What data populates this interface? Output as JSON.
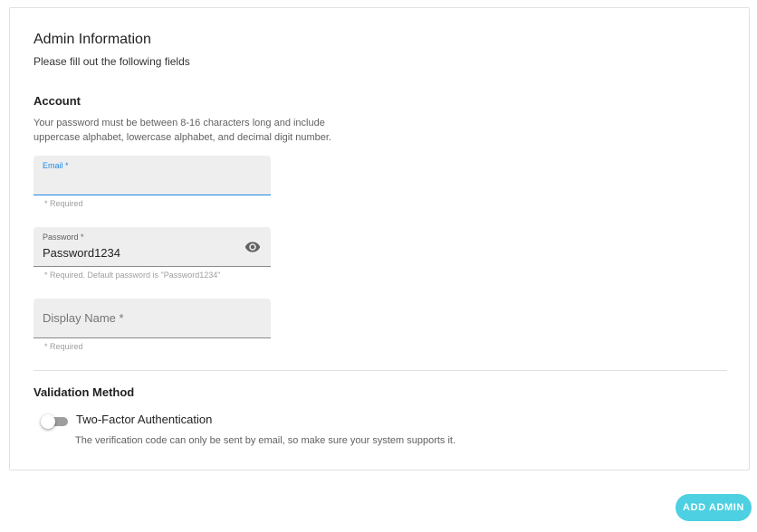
{
  "header": {
    "title": "Admin Information",
    "subtitle": "Please fill out the following fields"
  },
  "account": {
    "title": "Account",
    "hint_line1": "Your password must be between 8-16 characters long and include",
    "hint_line2": "uppercase alphabet, lowercase alphabet, and decimal digit number.",
    "email": {
      "label": "Email *",
      "value": "",
      "helper": "* Required"
    },
    "password": {
      "label": "Password *",
      "value": "Password1234",
      "helper": "* Required. Default password is \"Password1234\"",
      "icon": "eye-icon"
    },
    "display_name": {
      "label": "Display Name *",
      "value": "",
      "helper": "* Required"
    }
  },
  "validation": {
    "title": "Validation Method",
    "two_factor": {
      "label": "Two-Factor Authentication",
      "enabled": false,
      "description": "The verification code can only be sent by email, so make sure your system supports it."
    }
  },
  "actions": {
    "add_admin_label": "ADD ADMIN"
  },
  "colors": {
    "accent": "#4dd0e1",
    "focus": "#1e88e5",
    "field_bg": "#eeeeee"
  }
}
